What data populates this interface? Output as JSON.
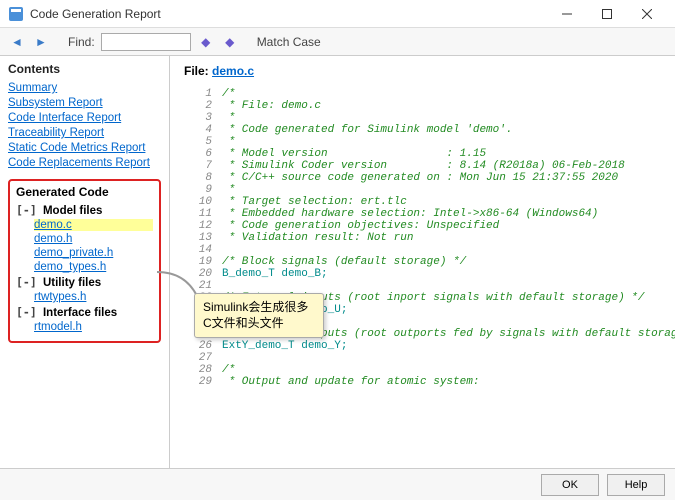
{
  "window": {
    "title": "Code Generation Report"
  },
  "toolbar": {
    "find_label": "Find:",
    "find_value": "",
    "match_case": "Match Case"
  },
  "sidebar": {
    "contents_title": "Contents",
    "nav": [
      "Summary",
      "Subsystem Report",
      "Code Interface Report",
      "Traceability Report",
      "Static Code Metrics Report",
      "Code Replacements Report"
    ],
    "generated_title": "Generated Code",
    "sections": [
      {
        "label": "Model files",
        "files": [
          "demo.c",
          "demo.h",
          "demo_private.h",
          "demo_types.h"
        ],
        "selected": 0
      },
      {
        "label": "Utility files",
        "files": [
          "rtwtypes.h"
        ]
      },
      {
        "label": "Interface files",
        "files": [
          "rtmodel.h"
        ]
      }
    ]
  },
  "content": {
    "file_label": "File:",
    "file_name": "demo.c",
    "lines": [
      {
        "n": 1,
        "t": "/*",
        "c": "cm"
      },
      {
        "n": 2,
        "t": " * File: demo.c",
        "c": "cm"
      },
      {
        "n": 3,
        "t": " *",
        "c": "cm"
      },
      {
        "n": 4,
        "t": " * Code generated for Simulink model 'demo'.",
        "c": "cm"
      },
      {
        "n": 5,
        "t": " *",
        "c": "cm"
      },
      {
        "n": 6,
        "t": " * Model version                  : 1.15",
        "c": "cm"
      },
      {
        "n": 7,
        "t": " * Simulink Coder version         : 8.14 (R2018a) 06-Feb-2018",
        "c": "cm"
      },
      {
        "n": 8,
        "t": " * C/C++ source code generated on : Mon Jun 15 21:37:55 2020",
        "c": "cm"
      },
      {
        "n": 9,
        "t": " *",
        "c": "cm"
      },
      {
        "n": 10,
        "t": " * Target selection: ert.tlc",
        "c": "cm"
      },
      {
        "n": 11,
        "t": " * Embedded hardware selection: Intel->x86-64 (Windows64)",
        "c": "cm"
      },
      {
        "n": 12,
        "t": " * Code generation objectives: Unspecified",
        "c": "cm"
      },
      {
        "n": 13,
        "t": " * Validation result: Not run",
        "c": "cm"
      },
      {
        "n": 14,
        "t": "",
        "c": ""
      },
      {
        "n": 19,
        "t": "/* Block signals (default storage) */",
        "c": "cm"
      },
      {
        "n": 20,
        "t": "B_demo_T demo_B;",
        "c": "tp"
      },
      {
        "n": 21,
        "t": "",
        "c": ""
      },
      {
        "n": 22,
        "t": "/* External inputs (root inport signals with default storage) */",
        "c": "cm"
      },
      {
        "n": 23,
        "t": "ExtU_demo_T demo_U;",
        "c": "tp"
      },
      {
        "n": 24,
        "t": "",
        "c": ""
      },
      {
        "n": 25,
        "t": "/* External outputs (root outports fed by signals with default storage) */",
        "c": "cm"
      },
      {
        "n": 26,
        "t": "ExtY_demo_T demo_Y;",
        "c": "tp"
      },
      {
        "n": 27,
        "t": "",
        "c": ""
      },
      {
        "n": 28,
        "t": "/*",
        "c": "cm"
      },
      {
        "n": 29,
        "t": " * Output and update for atomic system:",
        "c": "cm"
      }
    ]
  },
  "annotation": {
    "text": "Simulink会生成很多C文件和头文件"
  },
  "footer": {
    "ok": "OK",
    "help": "Help"
  }
}
